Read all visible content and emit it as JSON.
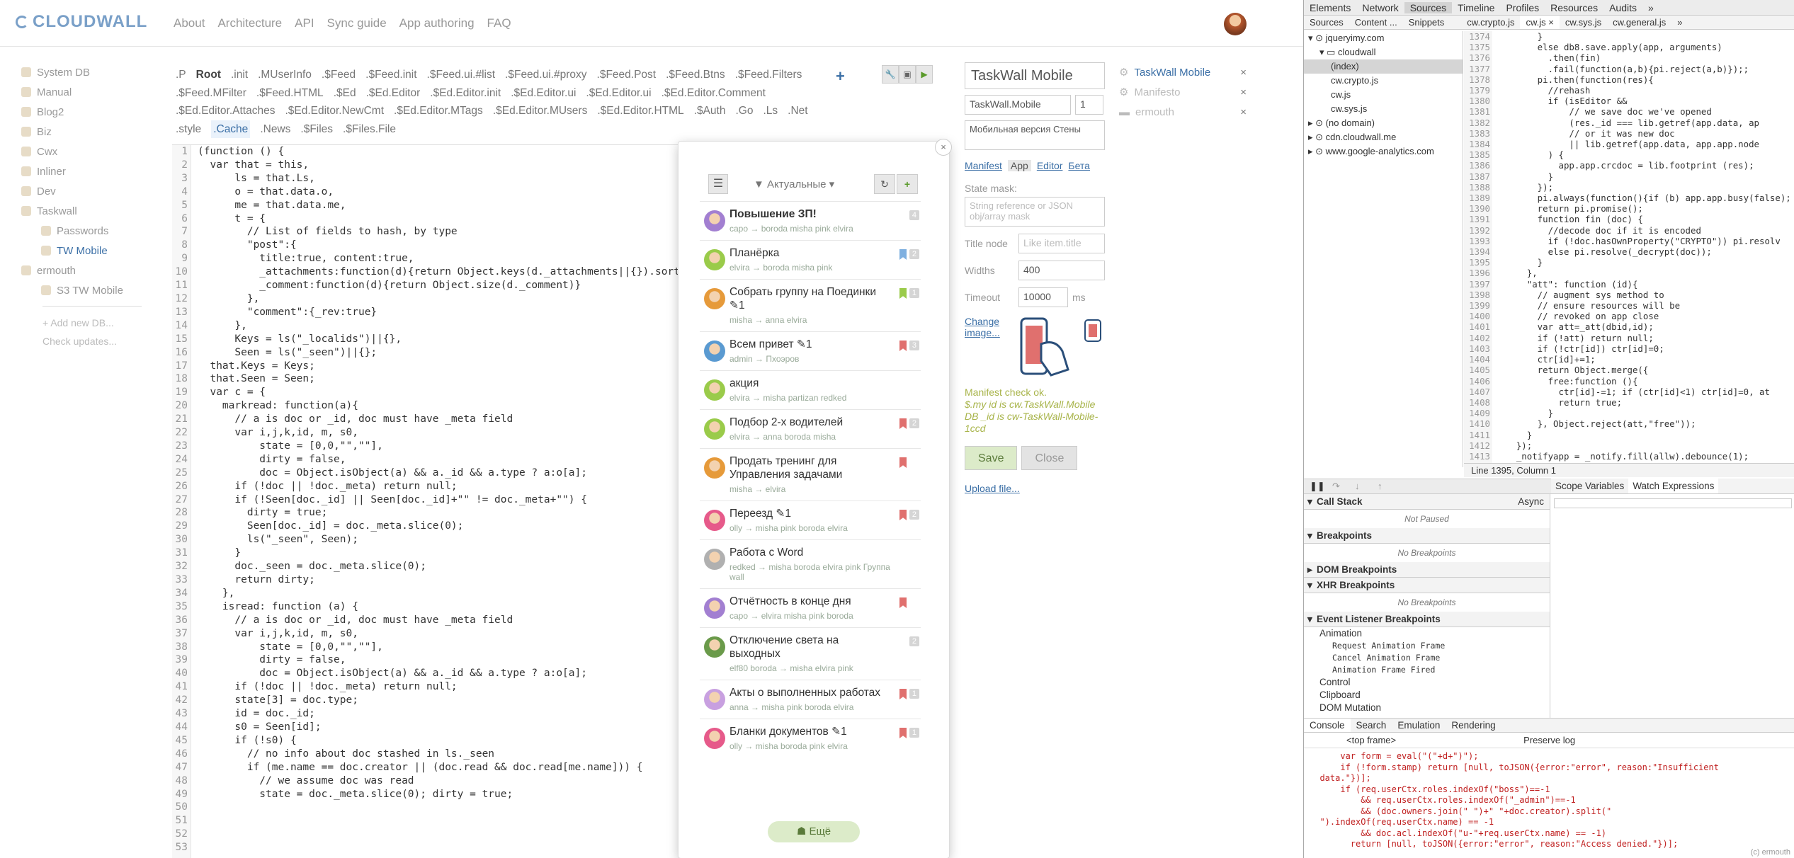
{
  "app": {
    "logo": "CLOUDWALL",
    "nav": [
      "About",
      "Architecture",
      "API",
      "Sync guide",
      "App authoring",
      "FAQ"
    ]
  },
  "sidebar": {
    "items": [
      {
        "label": "System DB",
        "sub": false,
        "active": false
      },
      {
        "label": "Manual",
        "sub": false,
        "active": false
      },
      {
        "label": "Blog2",
        "sub": false,
        "active": false
      },
      {
        "label": "Biz",
        "sub": false,
        "active": false
      },
      {
        "label": "Cwx",
        "sub": false,
        "active": false
      },
      {
        "label": "Inliner",
        "sub": false,
        "active": false
      },
      {
        "label": "Dev",
        "sub": false,
        "active": false
      },
      {
        "label": "Taskwall",
        "sub": false,
        "active": false
      },
      {
        "label": "Passwords",
        "sub": true,
        "active": false
      },
      {
        "label": "TW Mobile",
        "sub": true,
        "active": true
      },
      {
        "label": "ermouth",
        "sub": false,
        "active": false
      },
      {
        "label": "S3 TW Mobile",
        "sub": true,
        "active": false
      }
    ],
    "add_db": "+ Add new DB...",
    "check_updates": "Check updates..."
  },
  "editor_tabs": [
    {
      "t": ".P",
      "c": ""
    },
    {
      "t": "Root",
      "c": "b"
    },
    {
      "t": ".init",
      "c": ""
    },
    {
      "t": ".MUserInfo",
      "c": ""
    },
    {
      "t": ".$Feed",
      "c": ""
    },
    {
      "t": ".$Feed.init",
      "c": ""
    },
    {
      "t": ".$Feed.ui.#list",
      "c": ""
    },
    {
      "t": ".$Feed.ui.#proxy",
      "c": ""
    },
    {
      "t": ".$Feed.Post",
      "c": ""
    },
    {
      "t": ".$Feed.Btns",
      "c": ""
    },
    {
      "t": ".$Feed.Filters",
      "c": ""
    },
    {
      "t": ".$Feed.MFilter",
      "c": ""
    },
    {
      "t": ".$Feed.HTML",
      "c": ""
    },
    {
      "t": ".$Ed",
      "c": ""
    },
    {
      "t": ".$Ed.Editor",
      "c": ""
    },
    {
      "t": ".$Ed.Editor.init",
      "c": ""
    },
    {
      "t": ".$Ed.Editor.ui",
      "c": ""
    },
    {
      "t": ".$Ed.Editor.ui",
      "c": ""
    },
    {
      "t": ".$Ed.Editor.Comment",
      "c": ""
    },
    {
      "t": ".$Ed.Editor.Attaches",
      "c": ""
    },
    {
      "t": ".$Ed.Editor.NewCmt",
      "c": ""
    },
    {
      "t": ".$Ed.Editor.MTags",
      "c": ""
    },
    {
      "t": ".$Ed.Editor.MUsers",
      "c": ""
    },
    {
      "t": ".$Ed.Editor.HTML",
      "c": ""
    },
    {
      "t": ".$Auth",
      "c": ""
    },
    {
      "t": ".Go",
      "c": ""
    },
    {
      "t": ".Ls",
      "c": ""
    },
    {
      "t": ".Net",
      "c": ""
    },
    {
      "t": ".style",
      "c": ""
    },
    {
      "t": ".Cache",
      "c": "c"
    },
    {
      "t": ".News",
      "c": ""
    },
    {
      "t": ".$Files",
      "c": ""
    },
    {
      "t": ".$Files.File",
      "c": ""
    }
  ],
  "code_lines": [
    "(function () {",
    "  var that = this,",
    "      ls = that.Ls,",
    "      o = that.data.o,",
    "      me = that.data.me,",
    "      t = {",
    "        // List of fields to hash, by type",
    "        \"post\":{",
    "          title:true, content:true,",
    "          _attachments:function(d){return Object.keys(d._attachments||{}).sort()}",
    "          _comment:function(d){return Object.size(d._comment)}",
    "        },",
    "        \"comment\":{_rev:true}",
    "      },",
    "      Keys = ls(\"_localids\")||{},",
    "      Seen = ls(\"_seen\")||{};",
    "",
    "  that.Keys = Keys;",
    "  that.Seen = Seen;",
    "",
    "  var c = {",
    "    markread: function(a){",
    "      // a is doc or _id, doc must have _meta field",
    "      var i,j,k,id, m, s0,",
    "          state = [0,0,\"\",\"\"],",
    "          dirty = false,",
    "          doc = Object.isObject(a) && a._id && a.type ? a:o[a];",
    "      if (!doc || !doc._meta) return null;",
    "      if (!Seen[doc._id] || Seen[doc._id]+\"\" != doc._meta+\"\") {",
    "        dirty = true;",
    "        Seen[doc._id] = doc._meta.slice(0);",
    "        ls(\"_seen\", Seen);",
    "      }",
    "      doc._seen = doc._meta.slice(0);",
    "      return dirty;",
    "    },",
    "    isread: function (a) {",
    "      // a is doc or _id, doc must have _meta field",
    "      var i,j,k,id, m, s0,",
    "          state = [0,0,\"\",\"\"],",
    "          dirty = false,",
    "          doc = Object.isObject(a) && a._id && a.type ? a:o[a];",
    "",
    "      if (!doc || !doc._meta) return null;",
    "      state[3] = doc.type;",
    "      id = doc._id;",
    "      s0 = Seen[id];",
    "",
    "      if (!s0) {",
    "        // no info about doc stashed in ls._seen",
    "        if (me.name == doc.creator || (doc.read && doc.read[me.name])) {",
    "          // we assume doc was read",
    "          state = doc._meta.slice(0); dirty = true;"
  ],
  "modal": {
    "close": "×",
    "filter": "▼ Актуальные ▾",
    "more": "☗ Ещё",
    "tasks": [
      {
        "title": "Повышение ЗП!",
        "bold": true,
        "meta": "capo → boroda misha pink elvira",
        "flag": "",
        "count": "4",
        "av": "#a27fd1"
      },
      {
        "title": "Планёрка",
        "bold": false,
        "meta": "elvira → boroda misha pink",
        "flag": "#7fb0e0",
        "count": "2",
        "av": "#9acb4a"
      },
      {
        "title": "Собрать группу на Поединки  ✎1",
        "bold": false,
        "meta": "misha → anna elvira",
        "flag": "#9acb4a",
        "count": "1",
        "av": "#e69a3a"
      },
      {
        "title": "Всем привет  ✎1",
        "bold": false,
        "meta": "admin → Пхоэров",
        "flag": "#e0706e",
        "count": "3",
        "av": "#5a9ad1"
      },
      {
        "title": "акция",
        "bold": false,
        "meta": "elvira → misha partizan redked",
        "flag": "",
        "count": "",
        "av": "#9acb4a"
      },
      {
        "title": "Подбор 2-х водителей",
        "bold": false,
        "meta": "elvira → anna boroda misha",
        "flag": "#e0706e",
        "count": "2",
        "av": "#9acb4a"
      },
      {
        "title": "Продать тренинг для Управления задачами",
        "bold": false,
        "meta": "misha → elvira",
        "flag": "#e0706e",
        "count": "",
        "av": "#e69a3a"
      },
      {
        "title": "Переезд  ✎1",
        "bold": false,
        "meta": "olly → misha pink boroda elvira",
        "flag": "#e0706e",
        "count": "2",
        "av": "#e65a8a"
      },
      {
        "title": "Работа с Word",
        "bold": false,
        "meta": "redked → misha boroda elvira pink Группа wall",
        "flag": "",
        "count": "",
        "av": "#b0b0b0"
      },
      {
        "title": "Отчётность в конце дня",
        "bold": false,
        "meta": "capo → elvira misha pink boroda",
        "flag": "#e0706e",
        "count": "",
        "av": "#a27fd1"
      },
      {
        "title": "Отключение света на выходных",
        "bold": false,
        "meta": "elf80 boroda → misha elvira pink",
        "flag": "",
        "count": "2",
        "av": "#6a9a4a"
      },
      {
        "title": "Акты о выполненных работах",
        "bold": false,
        "meta": "anna → misha pink boroda elvira",
        "flag": "#e0706e",
        "count": "1",
        "av": "#c8a0e0"
      },
      {
        "title": "Бланки документов  ✎1",
        "bold": false,
        "meta": "olly → misha boroda pink elvira",
        "flag": "#e0706e",
        "count": "1",
        "av": "#e65a8a"
      }
    ]
  },
  "form": {
    "name": "TaskWall Mobile",
    "id": "TaskWall.Mobile",
    "version": "1",
    "descr": "Мобильная версия Стены",
    "tabs": [
      "Manifest",
      "App",
      "Editor",
      "Бета"
    ],
    "state_mask_label": "State mask:",
    "state_mask_ph": "String reference or JSON obj/array mask",
    "title_node_label": "Title node",
    "title_node_ph": "Like item.title",
    "widths_label": "Widths",
    "widths": "400",
    "timeout_label": "Timeout",
    "timeout": "10000",
    "timeout_unit": "ms",
    "change_image": "Change image...",
    "ok1": "Manifest check ok.",
    "ok2": "$.my id is cw.TaskWall.Mobile",
    "ok3": "DB _id is cw-TaskWall-Mobile-1ccd",
    "save": "Save",
    "close": "Close",
    "upload": "Upload file..."
  },
  "files": [
    {
      "name": "TaskWall Mobile",
      "active": true
    },
    {
      "name": "Manifesto",
      "active": false
    },
    {
      "name": "ermouth",
      "active": false
    }
  ],
  "devtools": {
    "tabs": [
      "Elements",
      "Network",
      "Sources",
      "Timeline",
      "Profiles",
      "Resources",
      "Audits",
      "»"
    ],
    "subtabs": [
      "Sources",
      "Content ...",
      "Snippets"
    ],
    "filetabs": [
      "cw.crypto.js",
      "cw.js ×",
      "cw.sys.js",
      "cw.general.js",
      "»"
    ],
    "tree": [
      {
        "t": "▾ ⊙ jqueryimy.com",
        "sel": false,
        "i": 0
      },
      {
        "t": "▾ ▭ cloudwall",
        "sel": false,
        "i": 1
      },
      {
        "t": "(index)",
        "sel": true,
        "i": 2
      },
      {
        "t": "cw.crypto.js",
        "sel": false,
        "i": 2
      },
      {
        "t": "cw.js",
        "sel": false,
        "i": 2
      },
      {
        "t": "cw.sys.js",
        "sel": false,
        "i": 2
      },
      {
        "t": "▸ ⊙ (no domain)",
        "sel": false,
        "i": 0
      },
      {
        "t": "▸ ⊙ cdn.cloudwall.me",
        "sel": false,
        "i": 0
      },
      {
        "t": "▸ ⊙ www.google-analytics.com",
        "sel": false,
        "i": 0
      }
    ],
    "line_start": 1374,
    "code": [
      "        }",
      "        else db8.save.apply(app, arguments)",
      "          .then(fin)",
      "          .fail(function(a,b){pi.reject(a,b)});;",
      "",
      "        pi.then(function(res){",
      "          //rehash",
      "          if (isEditor &&",
      "              // we save doc we've opened",
      "              (res._id === lib.getref(app.data, ap",
      "              // or it was new doc",
      "              || lib.getref(app.data, app.app.node",
      "          ) {",
      "            app.app.crcdoc = lib.footprint (res);",
      "          }",
      "        });",
      "        pi.always(function(){if (b) app.app.busy(false);",
      "        return pi.promise();",
      "",
      "        function fin (doc) {",
      "          //decode doc if it is encoded",
      "          if (!doc.hasOwnProperty(\"CRYPTO\")) pi.resolv",
      "          else pi.resolve(_decrypt(doc));",
      "        }",
      "      },",
      "      \"att\": function (id){",
      "        // augment sys method to",
      "        // ensure resources will be",
      "        // revoked on app close",
      "        var att=_att(dbid,id);",
      "        if (!att) return null;",
      "        if (!ctr[id]) ctr[id]=0;",
      "        ctr[id]+=1;",
      "        return Object.merge({",
      "          free:function (){",
      "            ctr[id]-=1; if (ctr[id]<1) ctr[id]=0, at",
      "            return true;",
      "          }",
      "        }, Object.reject(att,\"free\"));",
      "      }",
      "    });",
      "",
      "    _notifyapp = _notify.fill(allw).debounce(1);"
    ],
    "status": "Line 1395, Column 1",
    "callstack": "Call Stack",
    "async": "Async",
    "not_paused": "Not Paused",
    "breakpoints": "Breakpoints",
    "no_bp": "No Breakpoints",
    "dom_bp": "DOM Breakpoints",
    "xhr_bp": "XHR Breakpoints",
    "ev_bp": "Event Listener Breakpoints",
    "animation": "Animation",
    "anim_items": [
      "Request Animation Frame",
      "Cancel Animation Frame",
      "Animation Frame Fired"
    ],
    "control": "Control",
    "clipboard": "Clipboard",
    "dommut": "DOM Mutation",
    "scope_tabs": [
      "Scope Variables",
      "Watch Expressions"
    ],
    "console_tabs": [
      "Console",
      "Search",
      "Emulation",
      "Rendering"
    ],
    "frame": "<top frame>",
    "preserve": "Preserve log",
    "console_out": "      var form = eval(\"(\"+d+\")\");\n      if (!form.stamp) return [null, toJSON({error:\"error\", reason:\"Insufficient\n  data.\"})];\n      if (req.userCtx.roles.indexOf(\"boss\")==-1\n          && req.userCtx.roles.indexOf(\"_admin\")==-1\n          && (doc.owners.join(\" \")+\" \"+doc.creator).split(\"\n  \").indexOf(req.userCtx.name) == -1\n          && doc.acl.indexOf(\"u-\"+req.userCtx.name) == -1)\n        return [null, toJSON({error:\"error\", reason:\"Access denied.\"})];",
    "foot": "(c) ermouth"
  }
}
